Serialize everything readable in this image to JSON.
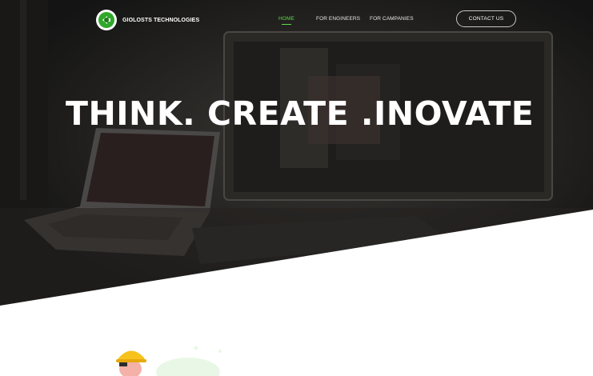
{
  "header": {
    "brand": "GIOLOSTS TECHNOLOGIES",
    "nav": [
      {
        "label": "HOME",
        "active": true
      },
      {
        "label": "FOR ENGINEERS",
        "active": false
      },
      {
        "label": "FOR CAMPANIES",
        "active": false
      }
    ],
    "contact_label": "CONTACT US"
  },
  "hero": {
    "headline": "THINK. CREATE .INOVATE"
  },
  "colors": {
    "accent": "#5fd94e",
    "hero_overlay": "#1c1c1c",
    "background": "#ffffff"
  },
  "icons": {
    "logo": "gs-logo-icon",
    "illustration": "worker-hardhat-illustration"
  }
}
